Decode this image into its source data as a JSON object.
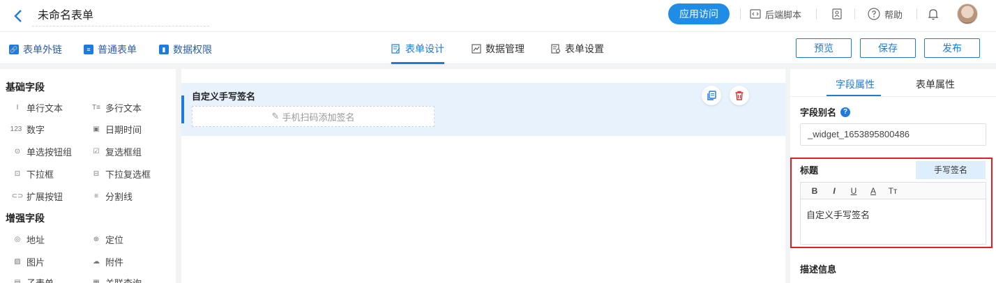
{
  "header": {
    "form_name": "未命名表单",
    "visit_button": "应用访问",
    "backend_script": "后端脚本",
    "help": "帮助"
  },
  "subbar": {
    "left_links": [
      "表单外链",
      "普通表单",
      "数据权限"
    ],
    "tabs": [
      "表单设计",
      "数据管理",
      "表单设置"
    ],
    "active_tab": "表单设计",
    "buttons": {
      "preview": "预览",
      "save": "保存",
      "publish": "发布"
    }
  },
  "left_panel": {
    "basic_title": "基础字段",
    "basic_fields": [
      "单行文本",
      "多行文本",
      "数字",
      "日期时间",
      "单选按钮组",
      "复选框组",
      "下拉框",
      "下拉复选框",
      "扩展按钮",
      "分割线"
    ],
    "enhanced_title": "增强字段",
    "enhanced_fields": [
      "地址",
      "定位",
      "图片",
      "附件",
      "子表单",
      "关联查询"
    ]
  },
  "canvas": {
    "field_label": "自定义手写签名",
    "signature_placeholder": "手机扫码添加签名"
  },
  "right_panel": {
    "tabs": [
      "字段属性",
      "表单属性"
    ],
    "active_tab": "字段属性",
    "alias_label": "字段别名",
    "alias_value": "_widget_1653895800486",
    "title_label": "标题",
    "handwrite_button": "手写签名",
    "editor_toolbar": [
      "B",
      "I",
      "U",
      "A",
      "Tт"
    ],
    "title_value": "自定义手写签名",
    "desc_label": "描述信息"
  },
  "colors": {
    "accent": "#1f7ae0",
    "highlight_outline": "#e02020",
    "selected_bg": "#e8f2fc"
  }
}
